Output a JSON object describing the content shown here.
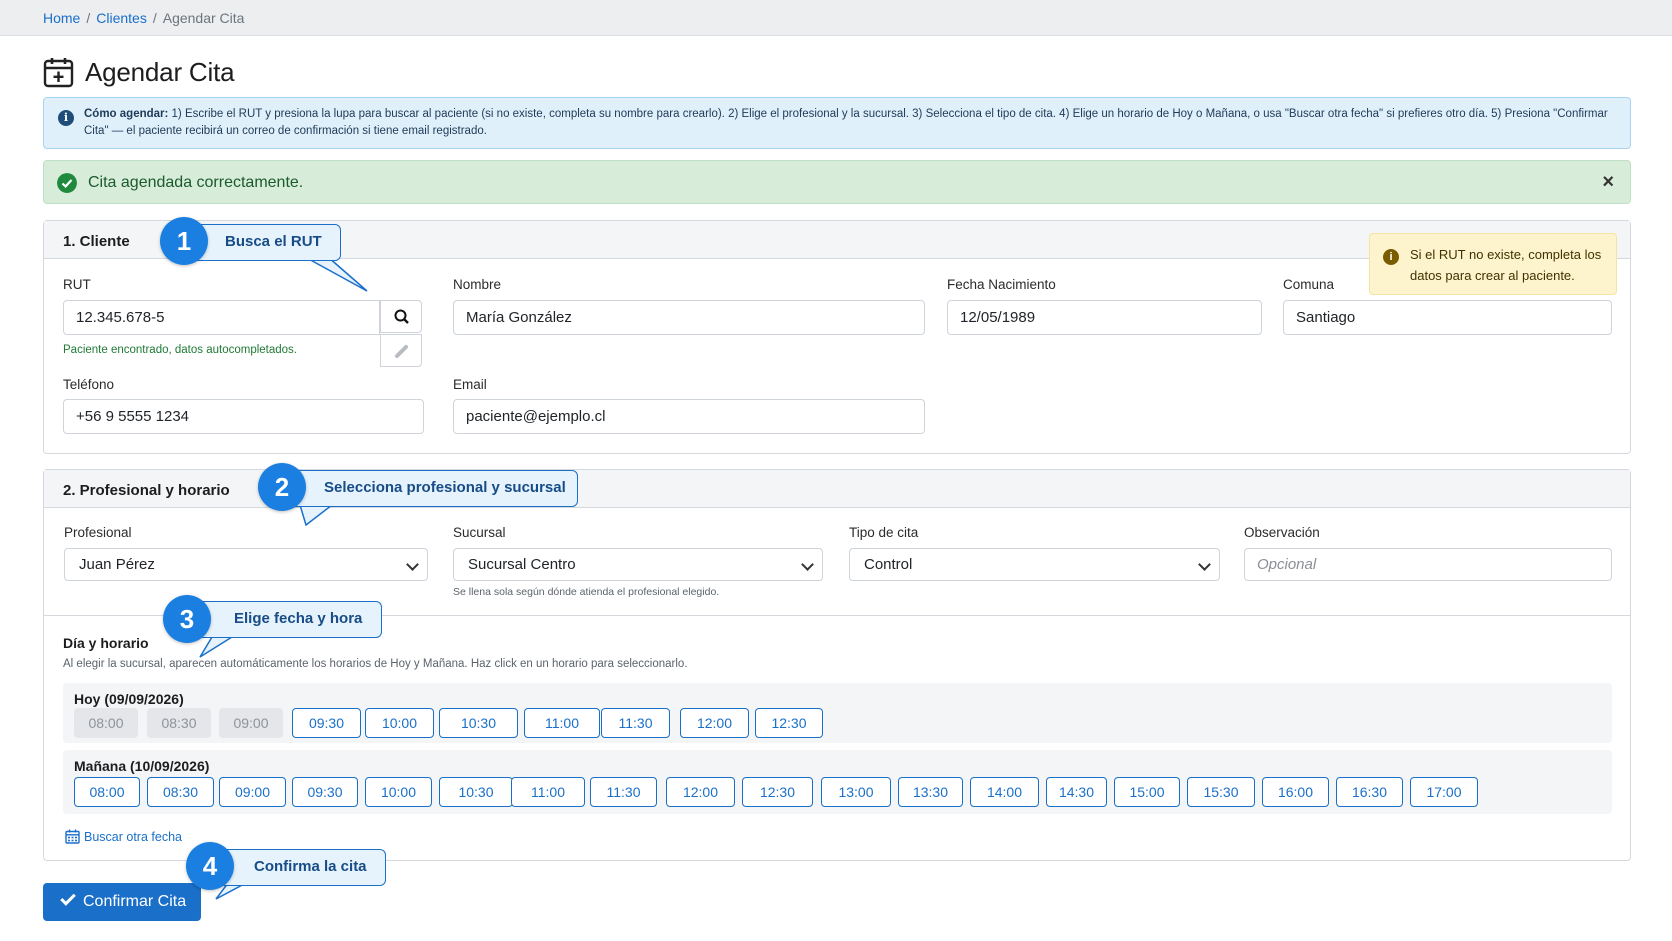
{
  "breadcrumb": {
    "home": "Home",
    "clientes": "Clientes",
    "current": "Agendar Cita",
    "sep": "/"
  },
  "page": {
    "title": "Agendar Cita"
  },
  "info": {
    "bold": "Cómo agendar:",
    "text": " 1) Escribe el RUT y presiona la lupa para buscar al paciente (si no existe, completa su nombre para crearlo). 2) Elige el profesional y la sucursal. 3) Selecciona el tipo de cita. 4) Elige un horario de Hoy o Mañana, o usa \"Buscar otra fecha\" si prefieres otro día. 5) Presiona \"Confirmar Cita\" — el paciente recibirá un correo de confirmación si tiene email registrado."
  },
  "alert": {
    "message": "Cita agendada correctamente.",
    "close": "×"
  },
  "cliente": {
    "header": "1. Cliente",
    "rut_label": "RUT",
    "rut_value": "12.345.678-5",
    "rut_hint": "Paciente encontrado, datos autocompletados.",
    "nombre_label": "Nombre",
    "nombre_value": "María González",
    "fecha_label": "Fecha Nacimiento",
    "fecha_value": "12/05/1989",
    "comuna_label": "Comuna",
    "comuna_value": "Santiago",
    "telefono_label": "Teléfono",
    "telefono_value": "+56 9 5555 1234",
    "email_label": "Email",
    "email_value": "paciente@ejemplo.cl",
    "warning": "Si el RUT no existe, completa los datos para crear al paciente."
  },
  "profesional": {
    "header": "2. Profesional y horario",
    "profesional_label": "Profesional",
    "profesional_value": "Juan Pérez",
    "sucursal_label": "Sucursal",
    "sucursal_value": "Sucursal Centro",
    "sucursal_hint": "Se llena sola según dónde atienda el profesional elegido.",
    "tipo_label": "Tipo de cita",
    "tipo_value": "Control",
    "obs_label": "Observación",
    "obs_placeholder": "Opcional",
    "dia_title": "Día y horario",
    "dia_hint": "Al elegir la sucursal, aparecen automáticamente los horarios de Hoy y Mañana. Haz click en un horario para seleccionarlo.",
    "hoy_label": "Hoy (09/09/2026)",
    "hoy_slots": [
      {
        "t": "08:00",
        "disabled": true
      },
      {
        "t": "08:30",
        "disabled": true
      },
      {
        "t": "09:00",
        "disabled": true
      },
      {
        "t": "09:30",
        "disabled": false
      },
      {
        "t": "10:00",
        "disabled": false
      },
      {
        "t": "10:30",
        "disabled": false
      },
      {
        "t": "11:00",
        "disabled": false
      },
      {
        "t": "11:30",
        "disabled": false
      },
      {
        "t": "12:00",
        "disabled": false
      },
      {
        "t": "12:30",
        "disabled": false
      }
    ],
    "manana_label": "Mañana (10/09/2026)",
    "manana_slots": [
      "08:00",
      "08:30",
      "09:00",
      "09:30",
      "10:00",
      "10:30",
      "11:00",
      "11:30",
      "12:00",
      "12:30",
      "13:00",
      "13:30",
      "14:00",
      "14:30",
      "15:00",
      "15:30",
      "16:00",
      "16:30",
      "17:00"
    ],
    "other_date": "Buscar otra fecha"
  },
  "confirm": {
    "label": "Confirmar Cita"
  },
  "callouts": [
    {
      "num": "1",
      "text": "Busca el RUT"
    },
    {
      "num": "2",
      "text": "Selecciona profesional y sucursal"
    },
    {
      "num": "3",
      "text": "Elige fecha y hora"
    },
    {
      "num": "4",
      "text": "Confirma la cita"
    }
  ],
  "colors": {
    "primary": "#1a6fc9",
    "success_bg": "#d7edda",
    "info_bg": "#dff0fb",
    "warning_bg": "#fdf3cd"
  },
  "icons": [
    "calendar-plus-icon",
    "info-icon",
    "check-circle-icon",
    "close-icon",
    "search-icon",
    "pencil-icon",
    "chevron-down-icon",
    "calendar-icon",
    "check-icon"
  ]
}
